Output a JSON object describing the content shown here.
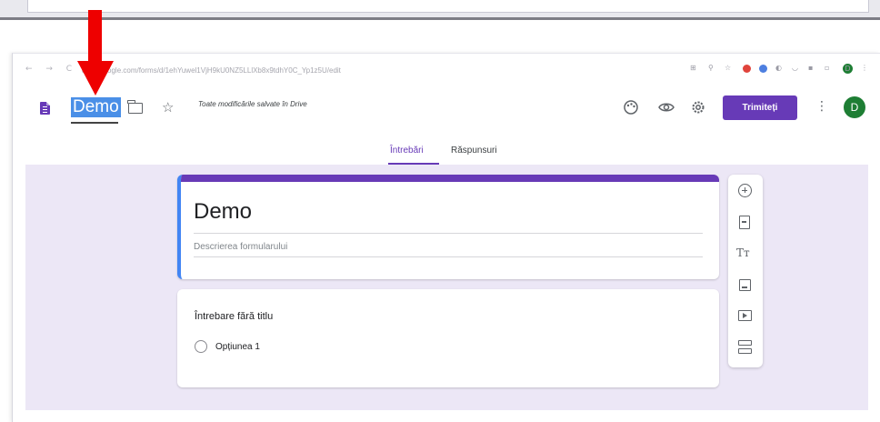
{
  "browser": {
    "url": "docs.google.com/forms/d/1ehYuwel1VjH9kU0NZ5LLlXb8x9tdhY0C_Yp1z5U/edit",
    "nav_glyphs": "← → C"
  },
  "header": {
    "doc_title": "Demo",
    "save_status": "Toate modificările salvate în Drive",
    "send_label": "Trimiteți",
    "avatar_letter": "D",
    "browser_avatar_letter": "D"
  },
  "tabs": [
    {
      "label": "Întrebări",
      "active": true
    },
    {
      "label": "Răspunsuri",
      "active": false
    }
  ],
  "form": {
    "title": "Demo",
    "description_placeholder": "Descrierea formularului",
    "question_title": "Întrebare fără titlu",
    "option_label": "Opțiunea 1"
  },
  "toolbar": {
    "title_glyph": "Tт"
  },
  "icons": {
    "forms": "forms-icon",
    "folder": "folder-icon",
    "star": "star-icon",
    "palette": "palette-icon",
    "preview": "eye-icon",
    "settings": "gear-icon",
    "more": "more-vert-icon"
  },
  "colors": {
    "accent": "#673ab7",
    "content_bg": "#ece7f6",
    "title_highlight": "#4a8fe7",
    "annotation_red": "#ee0000",
    "avatar": "#1e7e34"
  }
}
